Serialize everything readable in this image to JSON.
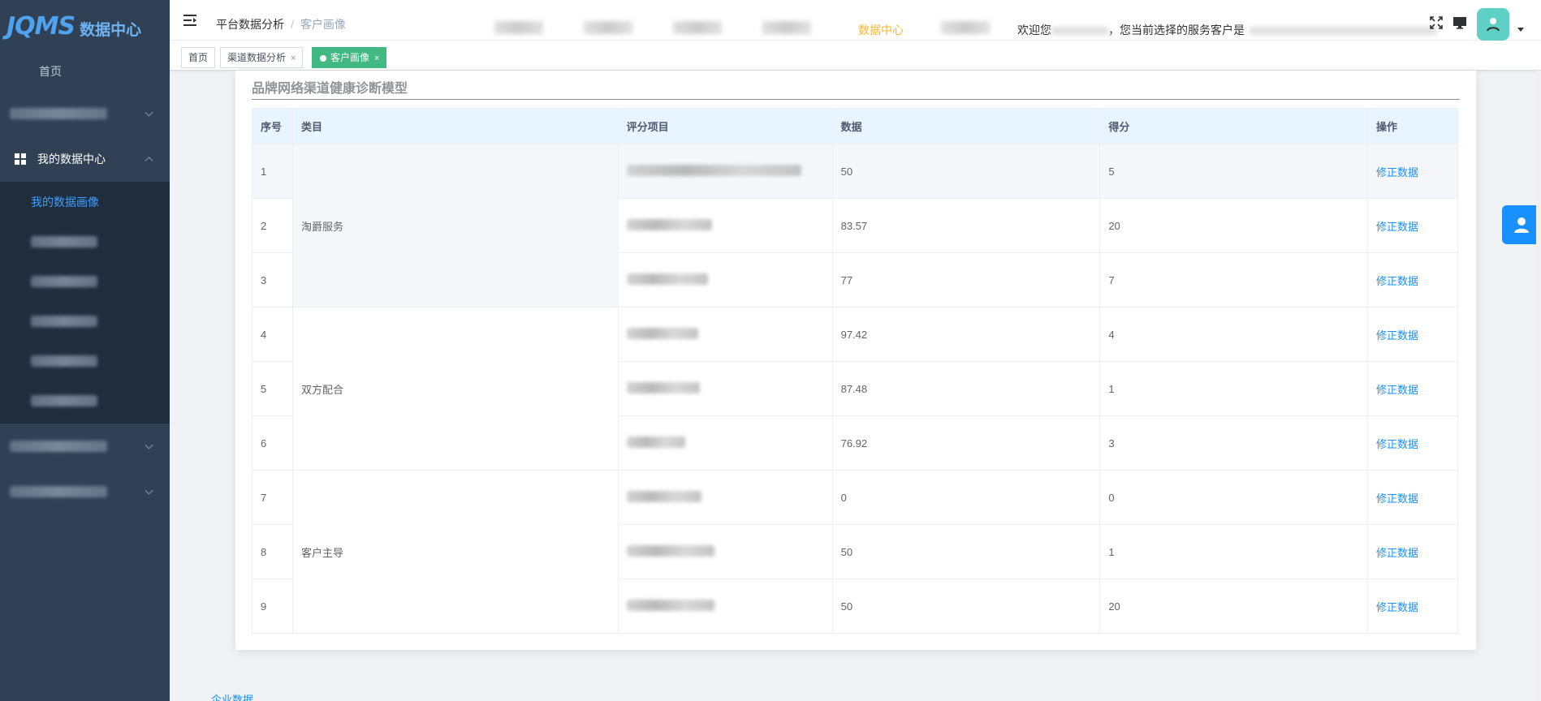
{
  "sidebar": {
    "logo_mark": "JQMS",
    "logo_text": "数据中心",
    "home_label": "首页",
    "active_group_label": "我的数据中心",
    "active_sub_label": "我的数据画像"
  },
  "navbar": {
    "breadcrumb": [
      "平台数据分析",
      "客户画像"
    ],
    "active_link": "数据中心",
    "welcome_prefix": "欢迎您",
    "welcome_middle": "，您当前选择的服务客户是"
  },
  "tags": [
    {
      "label": "首页"
    },
    {
      "label": "渠道数据分析",
      "close": "×"
    },
    {
      "label": "客户画像",
      "close": "×"
    }
  ],
  "section": {
    "title": "品牌网络渠道健康诊断模型"
  },
  "table": {
    "headers": [
      "序号",
      "类目",
      "评分项目",
      "数据",
      "得分",
      "操作"
    ],
    "categories": [
      "淘爵服务",
      "双方配合",
      "客户主导"
    ],
    "rows": [
      {
        "no": "1",
        "data": "50",
        "score": "5",
        "action": "修正数据"
      },
      {
        "no": "2",
        "data": "83.57",
        "score": "20",
        "action": "修正数据"
      },
      {
        "no": "3",
        "data": "77",
        "score": "7",
        "action": "修正数据"
      },
      {
        "no": "4",
        "data": "97.42",
        "score": "4",
        "action": "修正数据"
      },
      {
        "no": "5",
        "data": "87.48",
        "score": "1",
        "action": "修正数据"
      },
      {
        "no": "6",
        "data": "76.92",
        "score": "3",
        "action": "修正数据"
      },
      {
        "no": "7",
        "data": "0",
        "score": "0",
        "action": "修正数据"
      },
      {
        "no": "8",
        "data": "50",
        "score": "1",
        "action": "修正数据"
      },
      {
        "no": "9",
        "data": "50",
        "score": "20",
        "action": "修正数据"
      }
    ]
  },
  "footer": {
    "link": "企业数据"
  },
  "colors": {
    "sidebar_bg": "#304156",
    "accent": "#1890ff",
    "tag_active": "#42b983",
    "nav_active": "#f5b932"
  }
}
